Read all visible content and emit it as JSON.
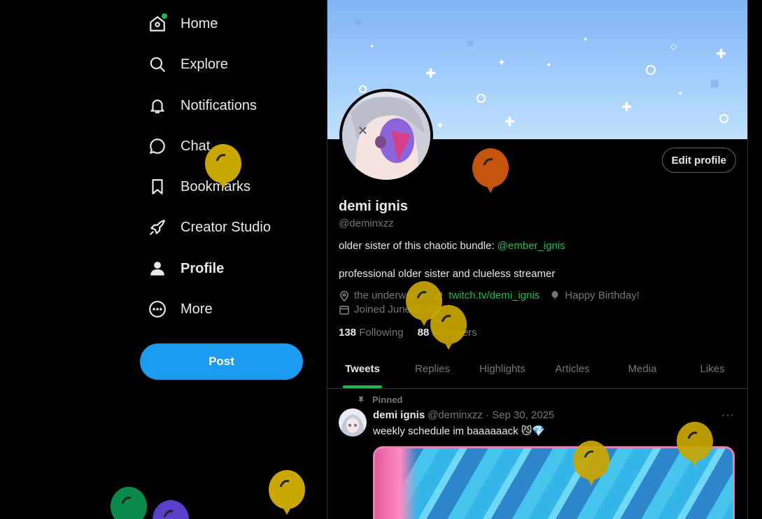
{
  "sidebar": {
    "items": [
      {
        "label": "Home",
        "icon": "home-icon"
      },
      {
        "label": "Explore",
        "icon": "search-icon"
      },
      {
        "label": "Notifications",
        "icon": "bell-icon"
      },
      {
        "label": "Chat",
        "icon": "chat-bubble-icon"
      },
      {
        "label": "Bookmarks",
        "icon": "bookmark-icon"
      },
      {
        "label": "Creator Studio",
        "icon": "rocket-icon"
      },
      {
        "label": "Profile",
        "icon": "person-icon"
      },
      {
        "label": "More",
        "icon": "more-circle-icon"
      }
    ],
    "post_label": "Post"
  },
  "profile": {
    "name": "demi ignis",
    "handle": "@deminxzz",
    "edit_label": "Edit profile",
    "bio_text": "older sister of this chaotic bundle: ",
    "bio_mention": "@ember_ignis",
    "bio_line2": "professional older sister and clueless streamer",
    "location": "the underworld",
    "website": "twitch.tv/demi_ignis",
    "birthday": "Happy Birthday!",
    "joined": "Joined June 2020",
    "following_count": "138",
    "following_label": "Following",
    "followers_count": "88",
    "followers_label": "Followers"
  },
  "tabs": [
    "Tweets",
    "Replies",
    "Highlights",
    "Articles",
    "Media",
    "Likes"
  ],
  "tweet": {
    "pinned_label": "Pinned",
    "author": "demi ignis",
    "meta": "@deminxzz · Sep 30, 2025",
    "more": "···",
    "text": "weekly schedule im baaaaaack 😼💎"
  },
  "colors": {
    "accent_green": "#1db954",
    "post_blue": "#1d9bf0",
    "balloon_gold": "#c9a600",
    "balloon_orange": "#c4540b",
    "balloon_green": "#0a8a4a",
    "balloon_purple": "#5b3ec9"
  }
}
